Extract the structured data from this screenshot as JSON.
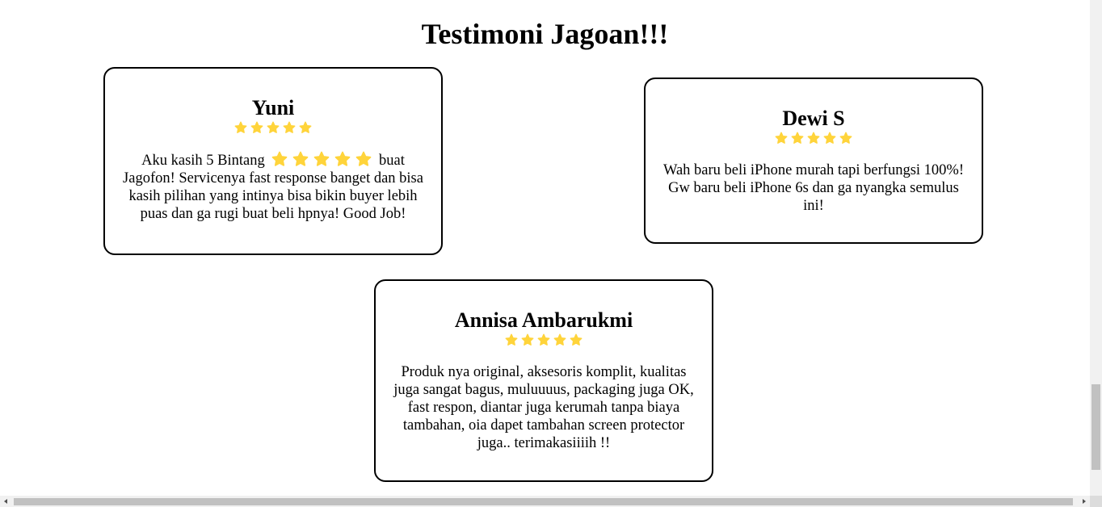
{
  "page": {
    "title": "Testimoni Jagoan!!!"
  },
  "colors": {
    "star": "#FFD43B",
    "border": "#000000"
  },
  "icons": {
    "rating": "star-icon"
  },
  "testimonials": [
    {
      "name": "Yuni",
      "rating": 5,
      "text_before": "Aku kasih 5 Bintang",
      "inline_stars": 5,
      "text_after": "buat Jagofon! Servicenya fast response banget dan bisa kasih pilihan yang intinya bisa bikin buyer lebih puas dan ga rugi buat beli hpnya! Good Job!"
    },
    {
      "name": "Dewi S",
      "rating": 5,
      "text": "Wah baru beli iPhone murah tapi berfungsi 100%! Gw baru beli iPhone 6s dan ga nyangka semulus ini!"
    },
    {
      "name": "Annisa Ambarukmi",
      "rating": 5,
      "text": "Produk nya original, aksesoris komplit, kualitas juga sangat bagus, muluuuus, packaging juga OK, fast respon, diantar juga kerumah tanpa biaya tambahan, oia dapet tambahan screen protector juga.. terimakasiiiih !!"
    }
  ]
}
